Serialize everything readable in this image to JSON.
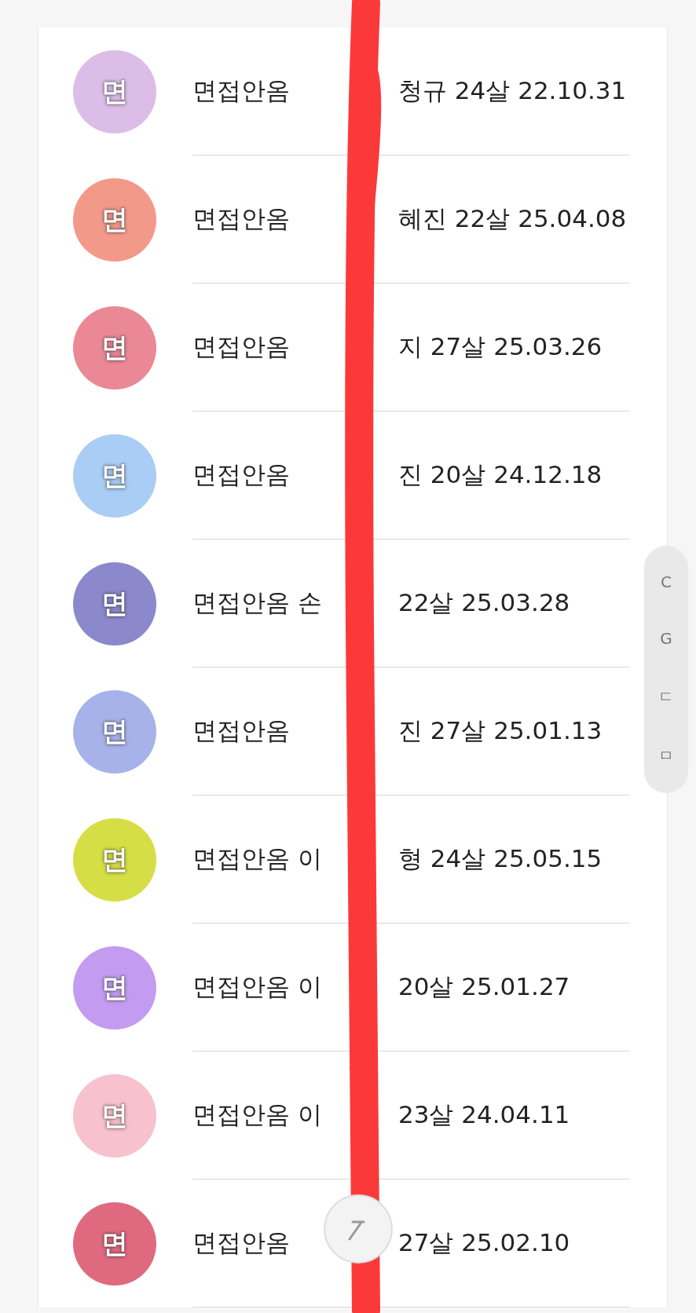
{
  "contacts": [
    {
      "avatar": "면",
      "color": "#dcbde8",
      "name_start": "면접안옴",
      "name_end": "청규 24살 22.10.31"
    },
    {
      "avatar": "면",
      "color": "#f3998a",
      "name_start": "면접안옴",
      "name_end": "혜진 22살 25.04.08"
    },
    {
      "avatar": "면",
      "color": "#eb8896",
      "name_start": "면접안옴",
      "name_end": "지 27살 25.03.26"
    },
    {
      "avatar": "면",
      "color": "#a9cdf4",
      "name_start": "면접안옴",
      "name_end": "진 20살 24.12.18"
    },
    {
      "avatar": "면",
      "color": "#8c88cc",
      "name_start": "면접안옴 손",
      "name_end": "22살 25.03.28"
    },
    {
      "avatar": "면",
      "color": "#a7b2ea",
      "name_start": "면접안옴",
      "name_end": "진 27살 25.01.13"
    },
    {
      "avatar": "면",
      "color": "#d6de45",
      "name_start": "면접안옴 이",
      "name_end": "형 24살 25.05.15"
    },
    {
      "avatar": "면",
      "color": "#c39cf1",
      "name_start": "면접안옴 이",
      "name_end": "20살 25.01.27"
    },
    {
      "avatar": "면",
      "color": "#f7c1cd",
      "name_start": "면접안옴 이",
      "name_end": "23살 24.04.11"
    },
    {
      "avatar": "면",
      "color": "#df6a80",
      "name_start": "면접안옴",
      "name_end": "27살 25.02.10"
    }
  ],
  "index": [
    "C",
    "G",
    "ㄷ",
    "ㅁ"
  ]
}
